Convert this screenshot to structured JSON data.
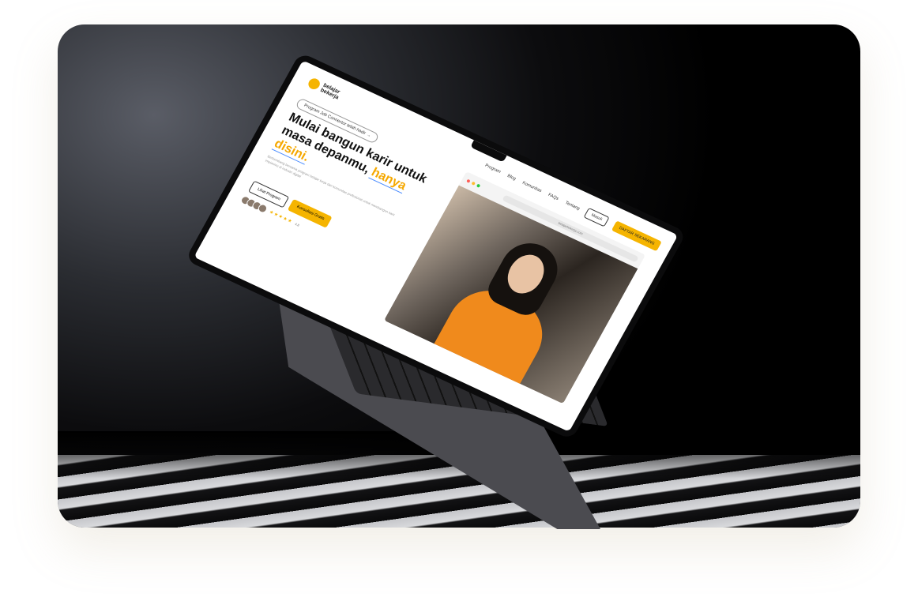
{
  "site": {
    "brand": "belajar\nbekerja",
    "nav_items": [
      "Program",
      "Blog",
      "Komunitas",
      "FAQs",
      "Tentang"
    ],
    "login_label": "Masuk",
    "cta_label": "DAFTAR SEKARANG",
    "badge": "Program Job Connector telah hadir →",
    "headline_main": "Mulai bangun karir untuk masa depanmu,",
    "headline_highlight1": "hanya",
    "headline_highlight2": "disini.",
    "subtext": "Berkembang bersama program belajar kerja dan komunitas profesional untuk membangun karir impianmu di industri digital",
    "btn_programs": "Lihat Program",
    "btn_consult": "Konsultasi Gratis",
    "rating_text": "4.8",
    "browser_url": "belajarbekerja.com"
  },
  "colors": {
    "accent": "#f5b400",
    "link_underline": "#4a8cff"
  }
}
